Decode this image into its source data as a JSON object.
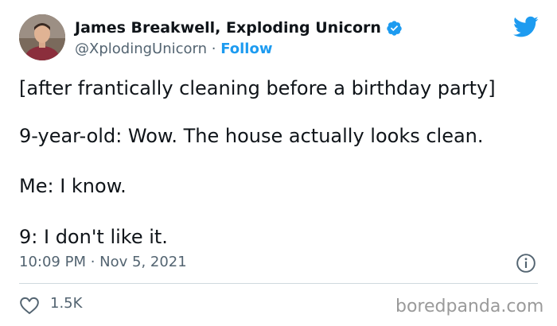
{
  "author": {
    "display_name": "James Breakwell, Exploding Unicorn",
    "handle": "@XplodingUnicorn",
    "separator": " · ",
    "follow_label": "Follow",
    "verified_icon": "verified-badge-icon",
    "avatar_icon": "profile-photo"
  },
  "tweet": {
    "lines": [
      "[after frantically cleaning before a birthday party]",
      "9-year-old: Wow. The house actually looks clean.",
      "Me: I know.",
      "9: I don't like it."
    ],
    "timestamp": "10:09 PM · Nov 5, 2021",
    "like_count": "1.5K"
  },
  "icons": {
    "brand": "twitter-bird-icon",
    "info": "info-icon",
    "like": "heart-icon"
  },
  "watermark": "boredpanda.com",
  "colors": {
    "accent": "#1d9bf0",
    "text": "#0f1419",
    "secondary": "#536471",
    "divider": "#cfd9de",
    "watermark": "#9a9a9a"
  }
}
